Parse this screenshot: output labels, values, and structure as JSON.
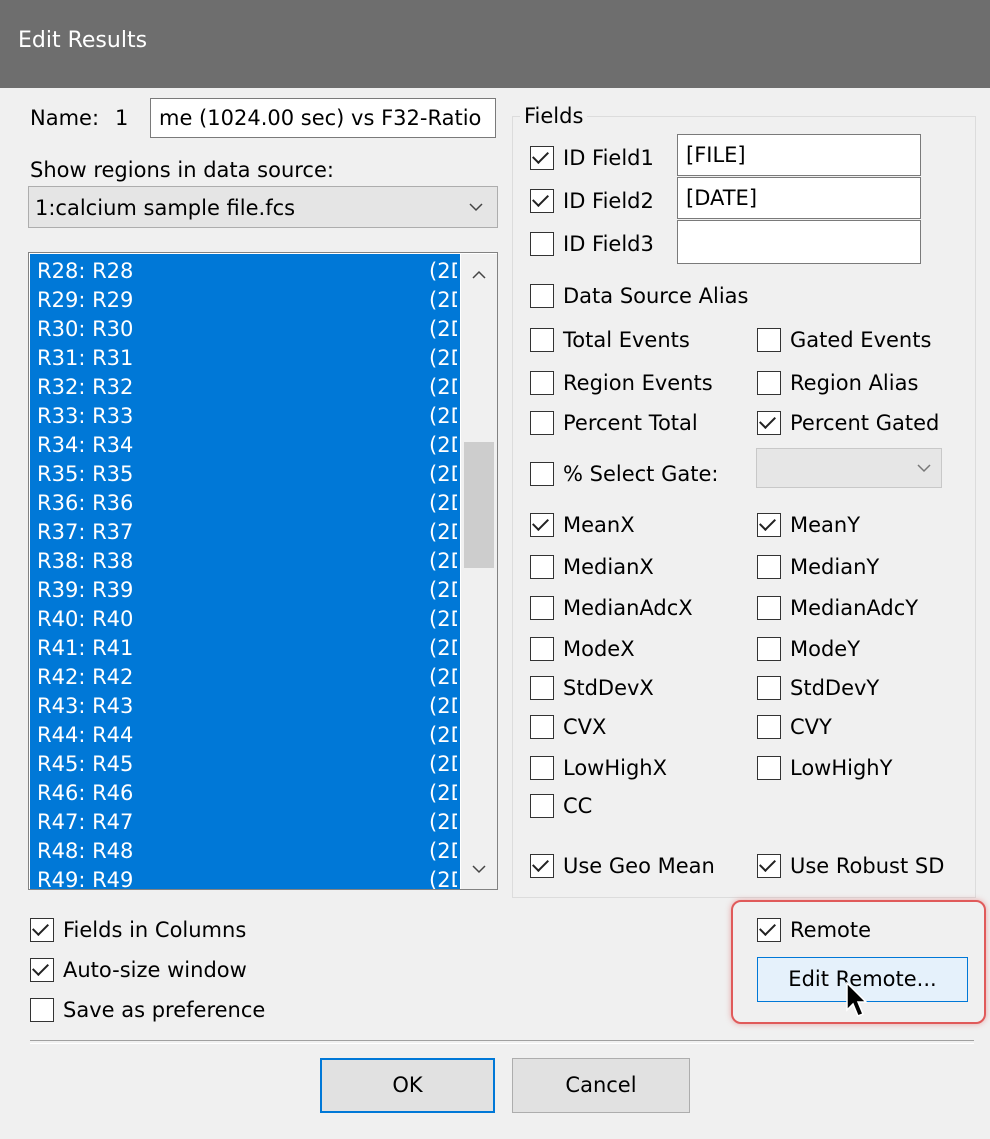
{
  "window": {
    "title": "Edit Results"
  },
  "name": {
    "label": "Name:",
    "number": "1",
    "value": "me (1024.00 sec) vs F32-Ratio"
  },
  "source": {
    "label": "Show regions in data source:",
    "selected": "1:calcium sample file.fcs"
  },
  "regions": [
    {
      "name": "R28: R28",
      "tag": "(2D"
    },
    {
      "name": "R29: R29",
      "tag": "(2D"
    },
    {
      "name": "R30: R30",
      "tag": "(2D"
    },
    {
      "name": "R31: R31",
      "tag": "(2D"
    },
    {
      "name": "R32: R32",
      "tag": "(2D"
    },
    {
      "name": "R33: R33",
      "tag": "(2D"
    },
    {
      "name": "R34: R34",
      "tag": "(2D"
    },
    {
      "name": "R35: R35",
      "tag": "(2D"
    },
    {
      "name": "R36: R36",
      "tag": "(2D"
    },
    {
      "name": "R37: R37",
      "tag": "(2D"
    },
    {
      "name": "R38: R38",
      "tag": "(2D"
    },
    {
      "name": "R39: R39",
      "tag": "(2D"
    },
    {
      "name": "R40: R40",
      "tag": "(2D"
    },
    {
      "name": "R41: R41",
      "tag": "(2D"
    },
    {
      "name": "R42: R42",
      "tag": "(2D"
    },
    {
      "name": "R43: R43",
      "tag": "(2D"
    },
    {
      "name": "R44: R44",
      "tag": "(2D"
    },
    {
      "name": "R45: R45",
      "tag": "(2D"
    },
    {
      "name": "R46: R46",
      "tag": "(2D"
    },
    {
      "name": "R47: R47",
      "tag": "(2D"
    },
    {
      "name": "R48: R48",
      "tag": "(2D"
    },
    {
      "name": "R49: R49",
      "tag": "(2D"
    }
  ],
  "fields": {
    "group_label": "Fields",
    "id1": {
      "label": "ID Field1",
      "checked": true,
      "value": "[FILE]"
    },
    "id2": {
      "label": "ID Field2",
      "checked": true,
      "value": "[DATE]"
    },
    "id3": {
      "label": "ID Field3",
      "checked": false,
      "value": ""
    },
    "data_source_alias": {
      "label": "Data Source Alias",
      "checked": false
    },
    "total_events": {
      "label": "Total Events",
      "checked": false
    },
    "gated_events": {
      "label": "Gated Events",
      "checked": false
    },
    "region_events": {
      "label": "Region Events",
      "checked": false
    },
    "region_alias": {
      "label": "Region Alias",
      "checked": false
    },
    "percent_total": {
      "label": "Percent Total",
      "checked": false
    },
    "percent_gated": {
      "label": "Percent Gated",
      "checked": true
    },
    "select_gate": {
      "label": "% Select Gate:",
      "checked": false,
      "value": ""
    },
    "meanx": {
      "label": "MeanX",
      "checked": true
    },
    "meany": {
      "label": "MeanY",
      "checked": true
    },
    "medianx": {
      "label": "MedianX",
      "checked": false
    },
    "mediany": {
      "label": "MedianY",
      "checked": false
    },
    "medianadcx": {
      "label": "MedianAdcX",
      "checked": false
    },
    "medianadcy": {
      "label": "MedianAdcY",
      "checked": false
    },
    "modex": {
      "label": "ModeX",
      "checked": false
    },
    "modey": {
      "label": "ModeY",
      "checked": false
    },
    "stddevx": {
      "label": "StdDevX",
      "checked": false
    },
    "stddevy": {
      "label": "StdDevY",
      "checked": false
    },
    "cvx": {
      "label": "CVX",
      "checked": false
    },
    "cvy": {
      "label": "CVY",
      "checked": false
    },
    "lowhighx": {
      "label": "LowHighX",
      "checked": false
    },
    "lowhighy": {
      "label": "LowHighY",
      "checked": false
    },
    "cc": {
      "label": "CC",
      "checked": false
    },
    "geo_mean": {
      "label": "Use Geo Mean",
      "checked": true
    },
    "robust_sd": {
      "label": "Use Robust SD",
      "checked": true
    }
  },
  "options": {
    "fields_in_columns": {
      "label": "Fields in Columns",
      "checked": true
    },
    "auto_size": {
      "label": "Auto-size window",
      "checked": true
    },
    "save_pref": {
      "label": "Save as preference",
      "checked": false
    }
  },
  "remote": {
    "label": "Remote",
    "checked": true,
    "button": "Edit Remote..."
  },
  "buttons": {
    "ok": "OK",
    "cancel": "Cancel"
  },
  "colors": {
    "selection": "#0078d7",
    "highlight_border": "#e05a5a",
    "title_bar": "#6e6e6e"
  }
}
